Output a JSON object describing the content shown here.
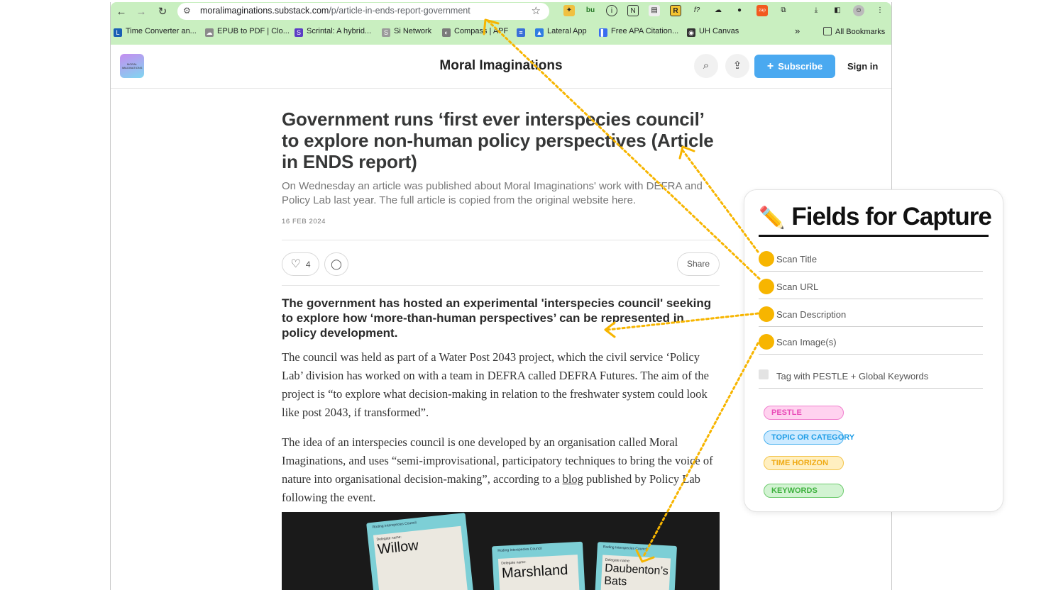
{
  "browser": {
    "url_host": "moralimaginations.substack.com",
    "url_path": "/p/article-in-ends-report-government",
    "bookmarks": [
      {
        "label": "Time Converter an...",
        "color": "#1a5fb4",
        "glyph": "L"
      },
      {
        "label": "EPUB to PDF | Clo...",
        "color": "#8a8a8a",
        "glyph": "☁"
      },
      {
        "label": "Scrintal: A hybrid...",
        "color": "#5b3cc4",
        "glyph": "S"
      },
      {
        "label": "Si Network",
        "color": "#9a9a9a",
        "glyph": "S"
      },
      {
        "label": "Compass | APF",
        "color": "#7a7a7a",
        "glyph": "◐"
      },
      {
        "label": "",
        "color": "#3a6fd8",
        "glyph": "≡"
      },
      {
        "label": "Lateral App",
        "color": "#2f7de1",
        "glyph": "▲"
      },
      {
        "label": "Free APA Citation...",
        "color": "#3b6df0",
        "glyph": "▌"
      },
      {
        "label": "UH Canvas",
        "color": "#333333",
        "glyph": "◉"
      }
    ],
    "all_bookmarks": "All Bookmarks"
  },
  "site": {
    "name": "Moral Imaginations",
    "logo_text": "MORAL IMAGINATIONS",
    "subscribe": "Subscribe",
    "sign_in": "Sign in"
  },
  "article": {
    "title": "Government runs ‘first ever interspecies council’ to explore non-human policy perspectives (Article in ENDS report)",
    "subtitle": "On Wednesday an article was published about Moral Imaginations' work with DEFRA and Policy Lab last year. The full article is copied from the original website here.",
    "date": "16 FEB 2024",
    "likes": "4",
    "share": "Share",
    "lede": "The government has hosted an experimental 'interspecies council' seeking to explore how ‘more-than-human perspectives’ can be represented in policy development.",
    "para1": "The council was held as part of a Water Post 2043 project, which the civil service ‘Policy Lab’ division has worked on with a team in DEFRA called DEFRA Futures. The aim of the project is “to explore what decision-making in relation to the freshwater system could look like post 2043, if transformed”.",
    "para2_before": "The idea of an interspecies council is one developed by an organisation called Moral Imaginations, and uses “semi-improvisational, participatory techniques to bring the voice of nature into organisational decision-making”, according to a ",
    "para2_link": "blog",
    "para2_after": " published by Policy Lab following the event.",
    "image_cards": [
      {
        "council": "Roding Interspecies Council",
        "delegate": "Delegate name:",
        "name": "Willow"
      },
      {
        "council": "Roding Interspecies Council",
        "delegate": "Delegate name:",
        "name": "Marshland"
      },
      {
        "council": "Roding Interspecies Council",
        "delegate": "Delegate name:",
        "name": "Daubenton’s Bats"
      }
    ]
  },
  "panel": {
    "icon": "pencil-icon",
    "title": "Fields for Capture",
    "fields": [
      "Scan Title",
      "Scan URL",
      "Scan Description",
      "Scan Image(s)"
    ],
    "tag_label": "Tag with PESTLE + Global Keywords",
    "chips": [
      "PESTLE",
      "TOPIC OR CATEGORY",
      "TIME HORIZON",
      "KEYWORDS"
    ]
  },
  "colors": {
    "chrome": "#c9efc0",
    "accent": "#4aa9f0",
    "dot": "#f7b500",
    "arrow": "#f7b500"
  }
}
